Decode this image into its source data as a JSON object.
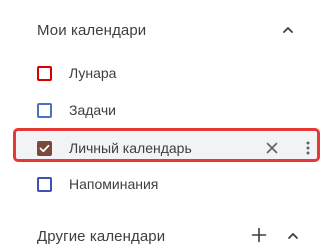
{
  "my_calendars": {
    "title": "Мои календари",
    "items": [
      {
        "label": "Лунара",
        "color": "#d50000",
        "checked": false
      },
      {
        "label": "Задачи",
        "color": "#4a73c8",
        "checked": false
      },
      {
        "label": "Личный календарь",
        "color": "#7a4a3c",
        "checked": true
      },
      {
        "label": "Напоминания",
        "color": "#3f51b5",
        "checked": false
      }
    ]
  },
  "other_calendars": {
    "title": "Другие календари"
  },
  "highlight_color": "#e53935",
  "icons": {
    "collapse": "chevron-up-icon",
    "add": "plus-icon",
    "remove": "close-icon",
    "options": "more-vertical-icon",
    "check": "checkmark-icon"
  }
}
